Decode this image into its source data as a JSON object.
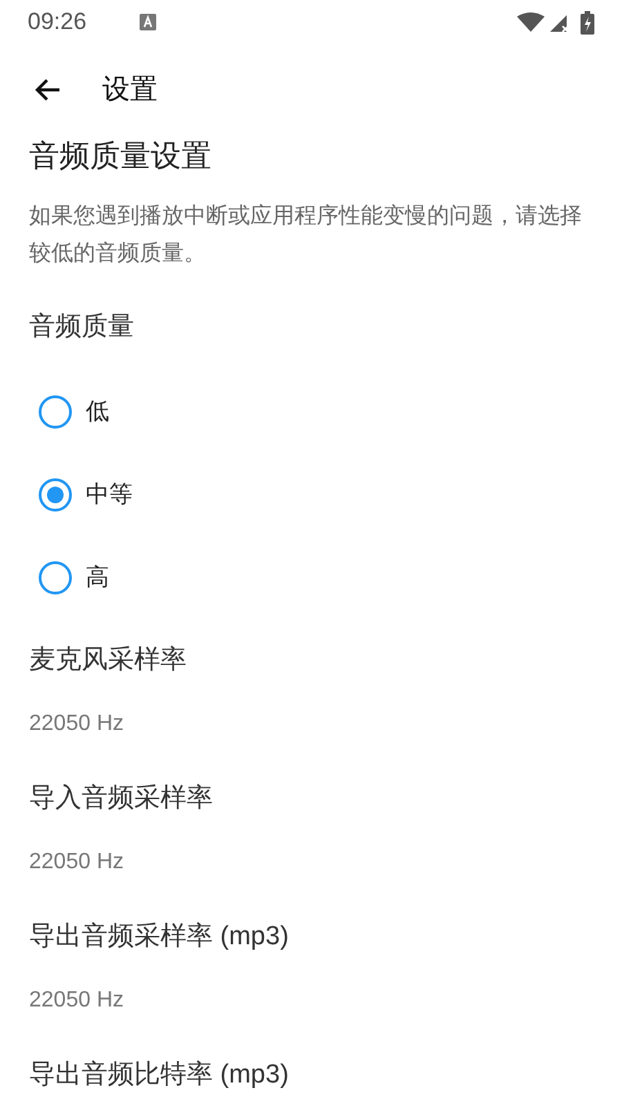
{
  "status_bar": {
    "time": "09:26"
  },
  "toolbar": {
    "title": "设置"
  },
  "section": {
    "title": "音频质量设置",
    "description": "如果您遇到播放中断或应用程序性能变慢的问题，请选择较低的音频质量。"
  },
  "quality": {
    "label": "音频质量",
    "options": [
      {
        "label": "低",
        "selected": false
      },
      {
        "label": "中等",
        "selected": true
      },
      {
        "label": "高",
        "selected": false
      }
    ]
  },
  "settings": [
    {
      "title": "麦克风采样率",
      "value": "22050 Hz"
    },
    {
      "title": "导入音频采样率",
      "value": "22050 Hz"
    },
    {
      "title": "导出音频采样率 (mp3)",
      "value": "22050 Hz"
    },
    {
      "title": "导出音频比特率 (mp3)"
    }
  ]
}
